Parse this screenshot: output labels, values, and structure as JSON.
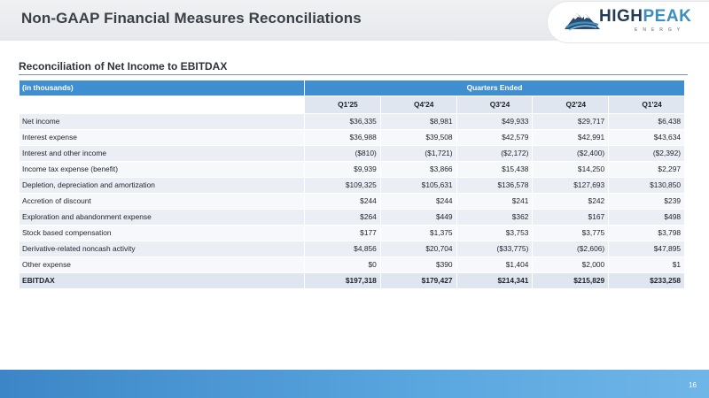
{
  "header": {
    "title": "Non-GAAP Financial Measures Reconciliations",
    "logo": {
      "word_dark": "HIGH",
      "word_light": "PEAK",
      "sub": "ENERGY",
      "icon": "mountain-peak-icon"
    }
  },
  "section": {
    "title": "Reconciliation of Net Income to EBITDAX"
  },
  "table": {
    "units_label": "(in thousands)",
    "group_label": "Quarters Ended",
    "columns": [
      "Q1'25",
      "Q4'24",
      "Q3'24",
      "Q2'24",
      "Q1'24"
    ],
    "rows": [
      {
        "label": "Net income",
        "values": [
          "$36,335",
          "$8,981",
          "$49,933",
          "$29,717",
          "$6,438"
        ]
      },
      {
        "label": "Interest expense",
        "values": [
          "$36,988",
          "$39,508",
          "$42,579",
          "$42,991",
          "$43,634"
        ]
      },
      {
        "label": "Interest and other income",
        "values": [
          "($810)",
          "($1,721)",
          "($2,172)",
          "($2,400)",
          "($2,392)"
        ]
      },
      {
        "label": "Income tax expense (benefit)",
        "values": [
          "$9,939",
          "$3,866",
          "$15,438",
          "$14,250",
          "$2,297"
        ]
      },
      {
        "label": "Depletion, depreciation and amortization",
        "values": [
          "$109,325",
          "$105,631",
          "$136,578",
          "$127,693",
          "$130,850"
        ]
      },
      {
        "label": "Accretion of discount",
        "values": [
          "$244",
          "$244",
          "$241",
          "$242",
          "$239"
        ]
      },
      {
        "label": "Exploration and abandonment expense",
        "values": [
          "$264",
          "$449",
          "$362",
          "$167",
          "$498"
        ]
      },
      {
        "label": "Stock based compensation",
        "values": [
          "$177",
          "$1,375",
          "$3,753",
          "$3,775",
          "$3,798"
        ]
      },
      {
        "label": "Derivative-related noncash activity",
        "values": [
          "$4,856",
          "$20,704",
          "($33,775)",
          "($2,606)",
          "$47,895"
        ]
      },
      {
        "label": "Other expense",
        "values": [
          "$0",
          "$390",
          "$1,404",
          "$2,000",
          "$1"
        ]
      },
      {
        "label": "EBITDAX",
        "values": [
          "$197,318",
          "$179,427",
          "$214,341",
          "$215,829",
          "$233,258"
        ],
        "total": true
      }
    ]
  },
  "footer": {
    "page_number": "16"
  },
  "colors": {
    "header_blue": "#3f8fd0",
    "footer_blue": "#4a97d6",
    "title_gray": "#3b3f46",
    "brand_dark": "#243b55",
    "brand_light": "#3a8fc0"
  }
}
